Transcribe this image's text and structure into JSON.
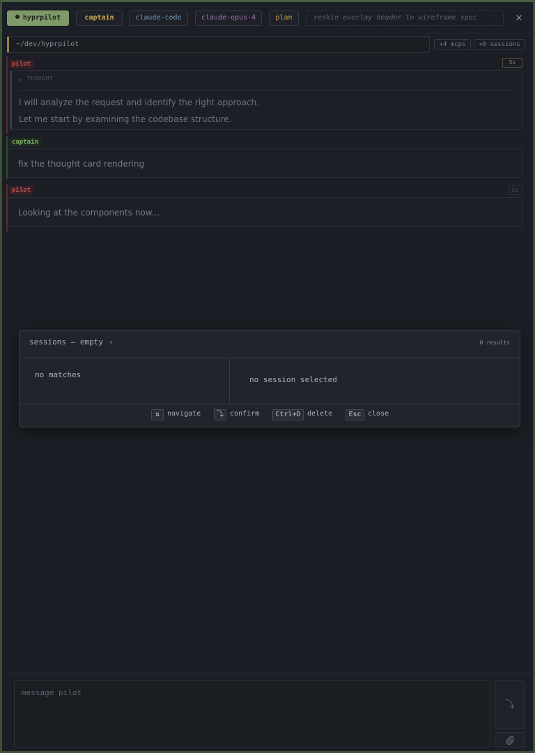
{
  "header": {
    "app_name": "hyprpilot",
    "captain_label": "captain",
    "agent_label": "claude-code",
    "model_label": "claude-opus-4",
    "mode_label": "plan",
    "task_title": "reskin overlay header to wireframe spec",
    "close_glyph": "✕"
  },
  "context": {
    "cwd": "~/dev/hyprpilot",
    "mcps_chip": "+4 mcps",
    "sessions_chip": "+0 sessions"
  },
  "messages": [
    {
      "role": "pilot",
      "time": "5s",
      "thought_label": "THOUGHT",
      "thought_lines": [
        "I will analyze the request and identify the right approach.",
        "Let me start by examining the codebase structure."
      ]
    },
    {
      "role": "captain",
      "text": "fix the thought card rendering"
    },
    {
      "role": "pilot",
      "time": "5s",
      "text": "Looking at the components now..."
    }
  ],
  "sessions_dialog": {
    "title": "sessions — empty",
    "title_arrow": "›",
    "results": "0 results",
    "empty_list": "no matches",
    "empty_preview": "no session selected",
    "hints": [
      {
        "key": "⇅",
        "label": "navigate"
      },
      {
        "key": "⤵",
        "label": "confirm"
      },
      {
        "key": "Ctrl+D",
        "label": "delete"
      },
      {
        "key": "Esc",
        "label": "close"
      }
    ]
  },
  "composer": {
    "placeholder": "message pilot",
    "send_glyph": "⤵"
  },
  "colors": {
    "accent_green": "#7f9a68",
    "pilot_red": "#b5545a",
    "captain_green": "#7fae6b",
    "captain_gold": "#c9a55a",
    "model_purple": "#a06fb0"
  }
}
